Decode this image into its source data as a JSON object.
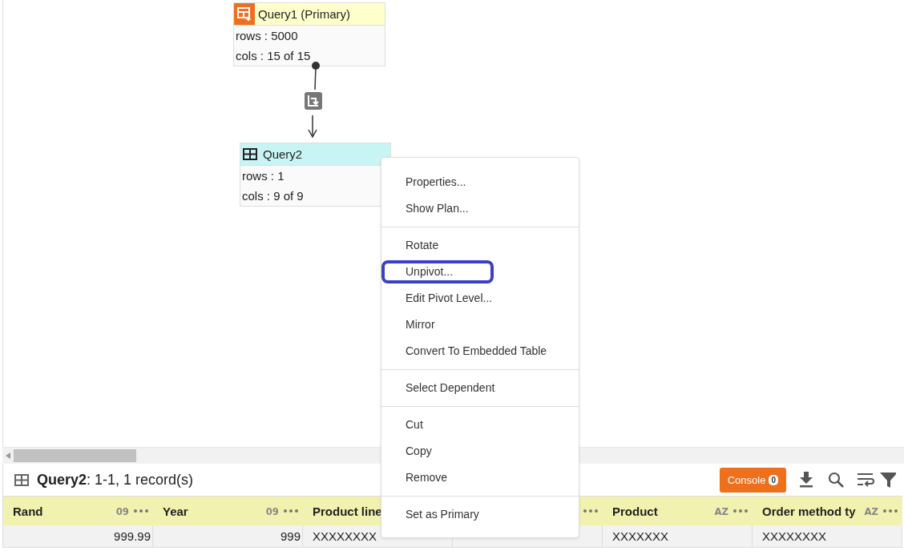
{
  "diagram": {
    "nodes": [
      {
        "kind": "primary",
        "title": "Query1 (Primary)",
        "lines": [
          "rows : 5000",
          "cols : 15 of 15"
        ]
      },
      {
        "kind": "query",
        "title": "Query2",
        "lines": [
          "rows : 1",
          "cols : 9 of 9"
        ]
      }
    ]
  },
  "context_menu": {
    "groups": [
      [
        {
          "label": "Properties...",
          "highlighted": false
        },
        {
          "label": "Show Plan...",
          "highlighted": false
        }
      ],
      [
        {
          "label": "Rotate",
          "highlighted": false
        },
        {
          "label": "Unpivot...",
          "highlighted": true
        },
        {
          "label": "Edit Pivot Level...",
          "highlighted": false
        },
        {
          "label": "Mirror",
          "highlighted": false
        },
        {
          "label": "Convert To Embedded Table",
          "highlighted": false
        }
      ],
      [
        {
          "label": "Select Dependent",
          "highlighted": false
        }
      ],
      [
        {
          "label": "Cut",
          "highlighted": false
        },
        {
          "label": "Copy",
          "highlighted": false
        },
        {
          "label": "Remove",
          "highlighted": false
        }
      ],
      [
        {
          "label": "Set as Primary",
          "highlighted": false
        }
      ]
    ]
  },
  "data_panel": {
    "title": "Query2",
    "summary": ": 1-1, 1 record(s)",
    "console": {
      "label": "Console",
      "count": "0"
    },
    "columns": [
      {
        "label": "Rand",
        "type": "09"
      },
      {
        "label": "Year",
        "type": "09"
      },
      {
        "label": "Product line"
      },
      {},
      {
        "label": "Product",
        "type": "AZ"
      },
      {
        "label": "Order method ty",
        "type": "AZ"
      }
    ],
    "rows": [
      [
        "999.99",
        "999",
        "XXXXXXXX",
        null,
        "XXXXXXX",
        "XXXXXXXX"
      ]
    ]
  }
}
